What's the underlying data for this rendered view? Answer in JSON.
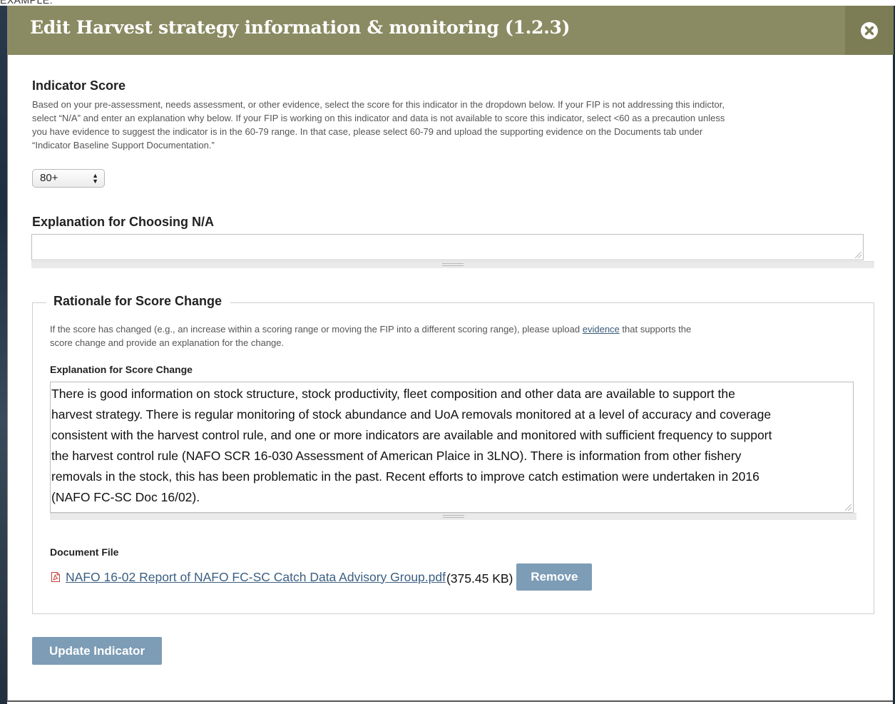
{
  "page": {
    "top_strip_text": "EXAMPLE:"
  },
  "modal": {
    "title": "Edit Harvest strategy information & monitoring (1.2.3)",
    "close_icon": "close-circle-icon"
  },
  "indicator_score": {
    "heading": "Indicator Score",
    "help_lines": [
      "Based on your pre-assessment, needs assessment, or other evidence, select the score for this indicator in the dropdown below. If your FIP is not addressing this indictor,",
      "select “N/A” and enter an explanation why below. If your FIP is working on this indicator and data is not available to score this indicator, select <60 as a precaution unless",
      "you have evidence to suggest the indicator is in the 60-79 range. In that case, please select 60-79 and upload the supporting evidence on the Documents tab under",
      "“Indicator Baseline Support Documentation.”"
    ],
    "selected_value": "80+"
  },
  "explanation_na": {
    "heading": "Explanation for Choosing N/A",
    "value": ""
  },
  "rationale": {
    "legend": "Rationale for Score Change",
    "help_line1_before": "If the score has changed (e.g., an increase within a scoring range or moving the FIP into a different scoring range), please upload ",
    "help_link": "evidence",
    "help_line1_after": " that supports the",
    "help_line2": "score change and provide an explanation for the change.",
    "explanation_label": "Explanation for Score Change",
    "explanation_lines": [
      "There is good information on stock structure, stock productivity, fleet composition and other data are available to support the",
      "harvest strategy. There is regular monitoring of stock abundance and UoA removals monitored at a level of accuracy and coverage",
      "consistent with the harvest control rule, and one or more indicators are available and monitored with sufficient frequency to support",
      "the harvest control rule  (NAFO SCR 16-030 Assessment of American Plaice in 3LNO). There is information from other fishery",
      "removals in the stock, this has been problematic in the past.  Recent efforts to improve catch estimation were undertaken in 2016",
      "(NAFO FC-SC Doc 16/02)."
    ],
    "document_label": "Document File",
    "document_icon": "pdf-icon",
    "document_name": "NAFO 16-02 Report of NAFO FC-SC Catch Data Advisory Group.pdf",
    "document_size": "(375.45 KB)",
    "remove_label": "Remove"
  },
  "actions": {
    "update_label": "Update Indicator"
  },
  "colors": {
    "header_bg": "#8a8b62",
    "close_bg": "#7c7d55",
    "button_bg": "#7d9cb6",
    "link": "#3b5f82"
  }
}
